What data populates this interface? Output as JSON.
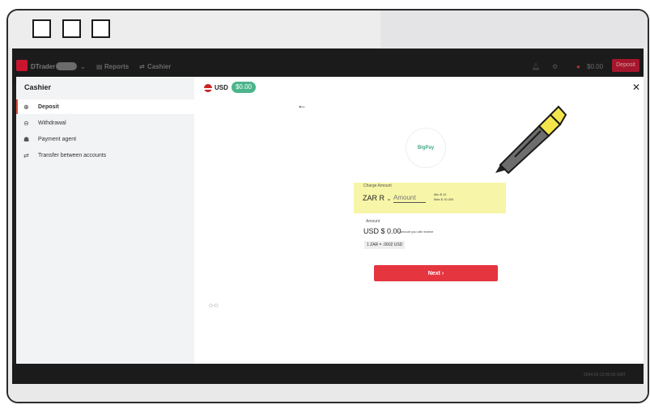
{
  "app": {
    "name": "DTrader",
    "nav": [
      "Reports",
      "Cashier"
    ],
    "header_balance": "$0.00",
    "deposit_label": "Deposit"
  },
  "cashier": {
    "title": "Cashier",
    "menu": [
      {
        "label": "Deposit",
        "icon": "deposit-icon",
        "active": true
      },
      {
        "label": "Withdrawal",
        "icon": "withdrawal-icon",
        "active": false
      },
      {
        "label": "Payment agent",
        "icon": "payment-agent-icon",
        "active": false
      },
      {
        "label": "Transfer between accounts",
        "icon": "transfer-icon",
        "active": false
      }
    ],
    "currency": "USD",
    "balance": "$0.00",
    "provider": "BigPay",
    "form": {
      "charge_label": "Charge Amount",
      "currency_select": "ZAR R",
      "amount_placeholder": "Amount",
      "min_label": "Min",
      "min_value": "$ 10",
      "max_label": "Max",
      "max_value": "$ 10,000",
      "amount_label": "Amount",
      "receive_value": "USD $ 0.00",
      "receive_note": "• Amount you will receive",
      "rate": "1 ZAR = .0602 USD",
      "next_label": "Next"
    }
  },
  "footer": {
    "timestamp": "2024-02-13 05:56 GMT"
  },
  "colors": {
    "accent": "#e5353f",
    "balance_badge": "#4bb48b",
    "highlight": "#f7f5a7"
  }
}
